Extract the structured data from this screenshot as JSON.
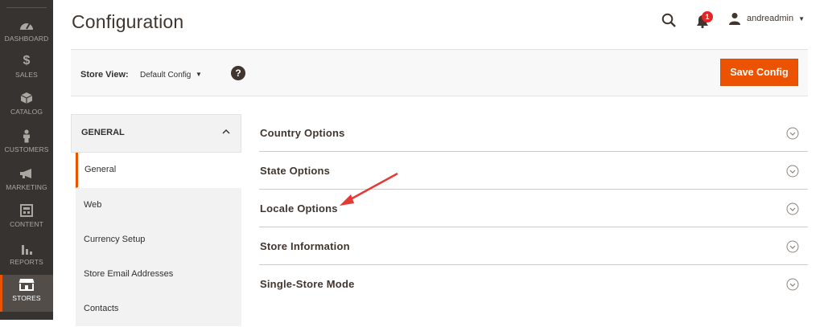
{
  "nav": {
    "items": [
      {
        "label": "DASHBOARD",
        "icon": "dashboard-icon"
      },
      {
        "label": "SALES",
        "icon": "dollar-icon"
      },
      {
        "label": "CATALOG",
        "icon": "cube-icon"
      },
      {
        "label": "CUSTOMERS",
        "icon": "person-icon"
      },
      {
        "label": "MARKETING",
        "icon": "megaphone-icon"
      },
      {
        "label": "CONTENT",
        "icon": "layout-icon"
      },
      {
        "label": "REPORTS",
        "icon": "bar-chart-icon"
      },
      {
        "label": "STORES",
        "icon": "storefront-icon"
      }
    ]
  },
  "header": {
    "title": "Configuration",
    "notification_count": "1",
    "username": "andreadmin"
  },
  "store_bar": {
    "label": "Store View:",
    "value": "Default Config",
    "help": "?",
    "save_label": "Save Config"
  },
  "config_tabs": {
    "heading": "GENERAL",
    "items": [
      "General",
      "Web",
      "Currency Setup",
      "Store Email Addresses",
      "Contacts"
    ]
  },
  "sections": [
    "Country Options",
    "State Options",
    "Locale Options",
    "Store Information",
    "Single-Store Mode"
  ],
  "colors": {
    "accent": "#eb5202",
    "sidebar": "#373330",
    "annotation_arrow": "#e53935"
  }
}
